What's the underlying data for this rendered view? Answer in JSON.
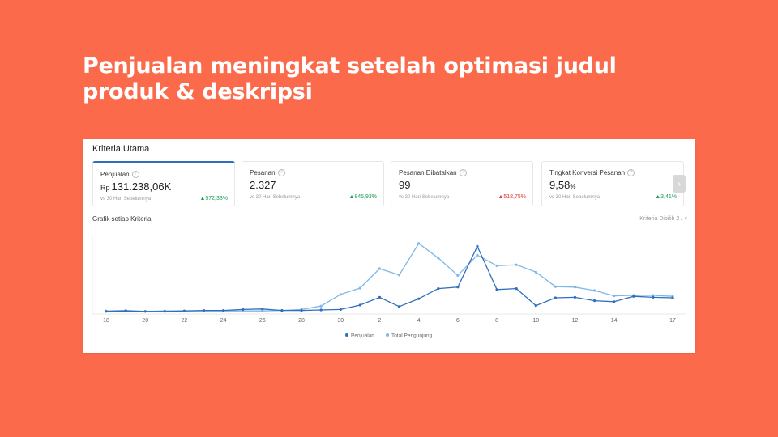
{
  "headline": "Penjualan meningkat setelah optimasi judul produk & deskripsi",
  "panel": {
    "title": "Kriteria Utama",
    "cards": [
      {
        "label": "Penjualan",
        "prefix": "Rp",
        "value": "131.238,06K",
        "suffix": "",
        "sub": "vs 30 Hari Sebelumnya",
        "delta": "▲572,33%",
        "trend": "up"
      },
      {
        "label": "Pesanan",
        "prefix": "",
        "value": "2.327",
        "suffix": "",
        "sub": "vs 30 Hari Sebelumnya",
        "delta": "▲845,93%",
        "trend": "up"
      },
      {
        "label": "Pesanan Dibatalkan",
        "prefix": "",
        "value": "99",
        "suffix": "",
        "sub": "vs 30 Hari Sebelumnya",
        "delta": "▲518,75%",
        "trend": "down"
      },
      {
        "label": "Tingkat Konversi Pesanan",
        "prefix": "",
        "value": "9,58",
        "suffix": "%",
        "sub": "vs 30 Hari Sebelumnya",
        "delta": "▲3,41%",
        "trend": "up"
      }
    ],
    "next_icon": "chevron-right-icon",
    "chart_title": "Grafik setiap Kriteria",
    "chart_meta": "Kriteria Dipilih 2 / 4"
  },
  "colors": {
    "background": "#fb6a4b",
    "penjualan": "#2f6fbd",
    "pengunjung": "#7fb8e6",
    "up": "#1f9e55",
    "down": "#e0382e"
  },
  "chart_data": {
    "type": "line",
    "x": [
      "18",
      "19",
      "20",
      "21",
      "22",
      "23",
      "24",
      "25",
      "26",
      "27",
      "28",
      "29",
      "30",
      "1",
      "2",
      "3",
      "4",
      "5",
      "6",
      "7",
      "8",
      "9",
      "10",
      "11",
      "12",
      "13",
      "14",
      "15",
      "16",
      "17"
    ],
    "tick_labels": [
      "18",
      "20",
      "22",
      "24",
      "26",
      "28",
      "30",
      "2",
      "4",
      "6",
      "8",
      "10",
      "12",
      "14",
      "17"
    ],
    "series": [
      {
        "name": "Penjualan",
        "values": [
          2,
          3,
          2,
          2,
          3,
          4,
          4,
          6,
          7,
          4,
          4,
          5,
          6,
          15,
          31,
          12,
          28,
          49,
          52,
          136,
          47,
          49,
          14,
          30,
          31,
          24,
          22,
          33,
          31,
          30
        ]
      },
      {
        "name": "Total Pengunjung",
        "values": [
          3,
          4,
          2,
          3,
          3,
          3,
          3,
          3,
          3,
          4,
          6,
          13,
          37,
          50,
          90,
          77,
          142,
          112,
          76,
          118,
          96,
          98,
          83,
          53,
          52,
          45,
          34,
          35,
          35,
          33
        ]
      }
    ],
    "ylim": [
      0,
      160
    ],
    "legend_position": "bottom"
  }
}
